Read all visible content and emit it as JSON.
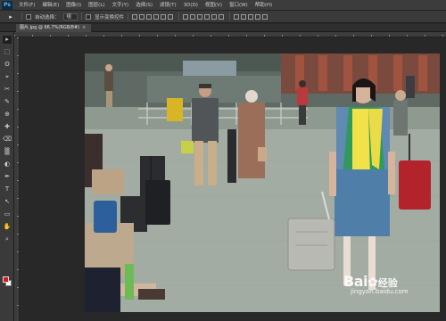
{
  "app": {
    "logo": "Ps"
  },
  "menu": {
    "items": [
      "文件(F)",
      "编辑(E)",
      "图像(I)",
      "图层(L)",
      "文字(Y)",
      "选择(S)",
      "滤镜(T)",
      "3D(D)",
      "视图(V)",
      "窗口(W)",
      "帮助(H)"
    ]
  },
  "options": {
    "tool_glyph": "▸",
    "auto_select_label": "自动选择：",
    "auto_select_value": "组",
    "show_transform_label": "显示变换控件"
  },
  "document": {
    "tab_label": "图片.jpg @ 66.7%(RGB/8#)",
    "close_glyph": "×"
  },
  "toolbox": {
    "tools": [
      "▸",
      "⬚",
      "ʘ",
      "⌖",
      "✂",
      "✎",
      "⊕",
      "✚",
      "⌫",
      "▒",
      "◐",
      "✒",
      "T",
      "↖",
      "▭",
      "✋",
      "⌕"
    ]
  },
  "colors": {
    "foreground": "#e0151b",
    "background": "#ffffff",
    "accent": "#5fb6f2"
  },
  "watermark": {
    "brand": "Bai",
    "brand_suffix": "经验",
    "url": "jingyan.baidu.com"
  }
}
